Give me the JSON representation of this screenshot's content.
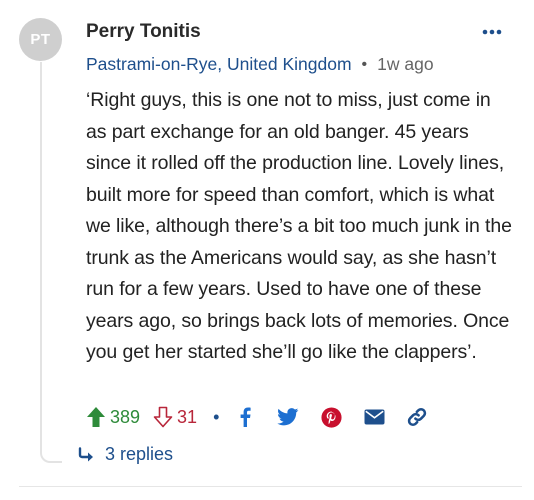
{
  "comment": {
    "avatar_initials": "PT",
    "author": "Perry Tonitis",
    "location": "Pastrami-on-Rye, United Kingdom",
    "separator": "•",
    "age": "1w ago",
    "text": "‘Right guys, this is one not to miss, just come in as part exchange for an old banger. 45 years since it rolled off the production line. Lovely lines, built more for speed than comfort, which is what we like, although there’s a bit too much junk in the trunk as the Americans would say, as she hasn’t run for a few years. Used to have one of these years ago, so brings back lots of memories. Once you get her started she’ll go like the clappers’.",
    "upvotes": "389",
    "downvotes": "31",
    "action_separator": "•",
    "replies_label": "3 replies"
  },
  "icons": {
    "more": "more-dots-icon",
    "upvote": "arrow-up-icon",
    "downvote": "arrow-down-icon",
    "facebook": "facebook-icon",
    "twitter": "twitter-icon",
    "pinterest": "pinterest-icon",
    "email": "email-icon",
    "link": "link-icon",
    "reply": "reply-arrow-icon"
  },
  "colors": {
    "accent_blue": "#1e4f8c",
    "share_blue": "#1d6fd1",
    "upvote_green": "#2e8b3a",
    "downvote_red": "#b8263a",
    "avatar_grey": "#cfcfcf"
  }
}
